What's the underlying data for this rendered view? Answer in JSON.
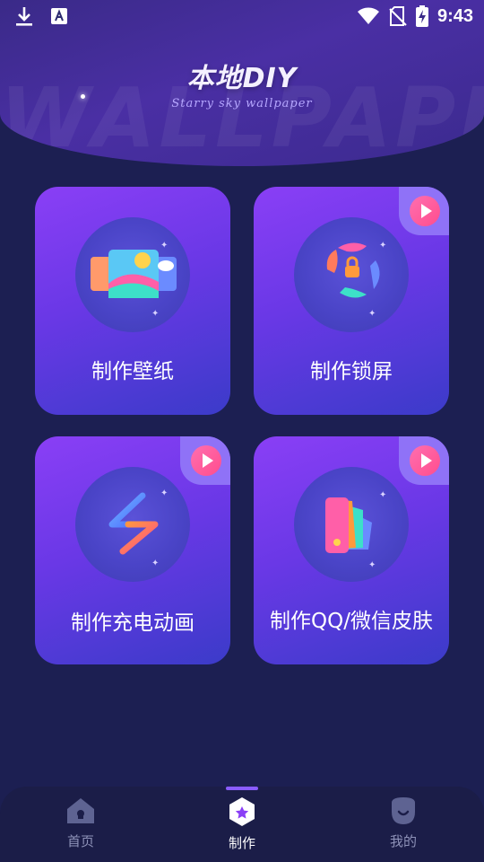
{
  "status_bar": {
    "time": "9:43",
    "left_icons": [
      "download-icon",
      "a-icon"
    ],
    "right_icons": [
      "wifi-icon",
      "no-sim-icon",
      "battery-charging-icon"
    ]
  },
  "header": {
    "title": "本地DIY",
    "subtitle": "Starry sky wallpaper",
    "watermark": "WALLPAPER"
  },
  "cards": [
    {
      "id": "wallpaper",
      "label": "制作壁纸",
      "icon": "image-gallery-icon",
      "has_video_badge": false
    },
    {
      "id": "lockscreen",
      "label": "制作锁屏",
      "icon": "lock-screen-icon",
      "has_video_badge": true
    },
    {
      "id": "charging",
      "label": "制作充电动画",
      "icon": "lightning-icon",
      "has_video_badge": true
    },
    {
      "id": "skin",
      "label": "制作QQ/微信皮肤",
      "icon": "color-palette-icon",
      "has_video_badge": true
    }
  ],
  "bottom_nav": {
    "items": [
      {
        "label": "首页",
        "icon": "home-icon",
        "active": false
      },
      {
        "label": "制作",
        "icon": "create-hexagon-icon",
        "active": true
      },
      {
        "label": "我的",
        "icon": "profile-icon",
        "active": false
      }
    ]
  },
  "colors": {
    "background": "#1c1f52",
    "card_gradient_start": "#8a3ff6",
    "card_gradient_end": "#3b3bc9",
    "play_badge": "#ff4d8d",
    "nav_active": "#8a5cff"
  }
}
